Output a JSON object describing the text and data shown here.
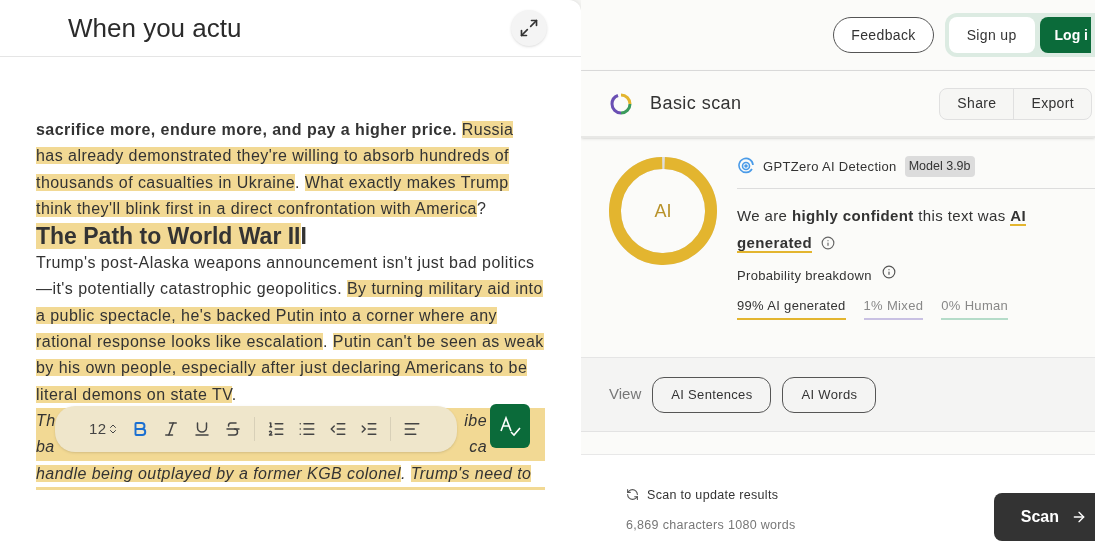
{
  "editor": {
    "title": "When you actu",
    "paragraphs": [
      {
        "kind": "text",
        "segments": [
          {
            "text": "sacrifice more, endure more, and pay a higher price. ",
            "kind": "bold"
          },
          {
            "text": "Russia has already demonstrated they're willing to absorb hundreds of thousands of casualties in Ukraine",
            "kind": "highlight"
          },
          {
            "text": ". ",
            "kind": "plain"
          },
          {
            "text": "What exactly makes Trump think they'll blink first in a direct confrontation with America",
            "kind": "highlight"
          },
          {
            "text": "?",
            "kind": "plain"
          }
        ]
      },
      {
        "kind": "heading",
        "segments": [
          {
            "text": "The Path to World War II",
            "kind": "highlight"
          },
          {
            "text": "I",
            "kind": "plain"
          }
        ]
      },
      {
        "kind": "text",
        "segments": [
          {
            "text": "Trump's post-Alaska weapons announcement isn't just bad politics—it's potentially catastrophic geopolitics. ",
            "kind": "plain"
          },
          {
            "text": "By turning military aid into a public spectacle, he's backed Putin into a corner where any rational response looks like escalation",
            "kind": "highlight"
          },
          {
            "text": ". ",
            "kind": "plain"
          },
          {
            "text": "Putin can't be seen as weak by his own people, especially after just declaring Americans to be literal demons on state TV",
            "kind": "highlight"
          },
          {
            "text": ".",
            "kind": "plain"
          }
        ]
      }
    ],
    "covered_lines": [
      {
        "left": "Th",
        "right": "ibe"
      },
      {
        "left": "ba",
        "right": "ca"
      }
    ],
    "last_line": [
      {
        "text": "handle being outplayed by a former KGB colonel",
        "kind": "highlight"
      },
      {
        "text": ". ",
        "kind": "plain"
      },
      {
        "text": "Trump's need to",
        "kind": "highlight"
      }
    ],
    "toolbar": {
      "font_size": "12",
      "formats": [
        {
          "kind": "bold",
          "selected": true
        },
        {
          "kind": "italic",
          "selected": false
        },
        {
          "kind": "underline",
          "selected": false
        },
        {
          "kind": "strike",
          "selected": false
        }
      ],
      "tools": [
        {
          "kind": "ordered-list"
        },
        {
          "kind": "bullet-list"
        },
        {
          "kind": "outdent"
        },
        {
          "kind": "indent"
        },
        {
          "kind": "divider"
        },
        {
          "kind": "align-left"
        }
      ]
    }
  },
  "header": {
    "feedback": "Feedback",
    "sign_up": "Sign up",
    "log_in": "Log i"
  },
  "scan": {
    "title": "Basic scan",
    "share": "Share",
    "export": "Export"
  },
  "result": {
    "label": "AI",
    "level": 0.99,
    "detector": "GPTZero AI Detection",
    "model": "Model 3.9b",
    "sentence": "We are **highly confident** this text was",
    "verdict": "AI generated",
    "breakdown_title": "Probability breakdown",
    "breakdown": [
      {
        "text": "99% AI generated",
        "color": "#e3b52f"
      },
      {
        "text": "1% Mixed",
        "color": "#c9c1e3"
      },
      {
        "text": "0% Human",
        "color": "#b5dcc9"
      }
    ]
  },
  "view": {
    "label": "View",
    "options": [
      "AI Sentences",
      "AI Words"
    ]
  },
  "footer": {
    "update": "Scan to update results",
    "counts": "6,869 characters 1080 words",
    "scan": "Scan"
  }
}
